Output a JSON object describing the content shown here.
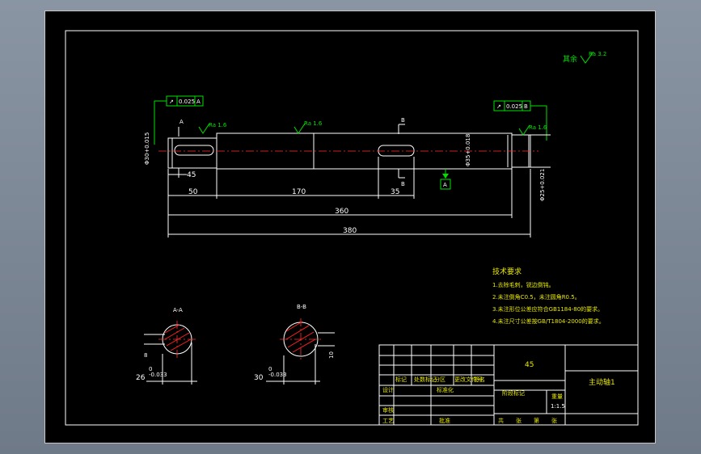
{
  "roughness_general": "Ra 3.2",
  "roughness_general_prefix": "其余",
  "roughness_left": "Ra 1.6",
  "roughness_mid": "Ra 1.6",
  "roughness_right": "Ra 1.6",
  "tol_frame_left": [
    "↗",
    "0.025",
    "A"
  ],
  "tol_frame_right": [
    "↗",
    "0.025",
    "B"
  ],
  "section_b_top": "B",
  "section_b_bottom": "B",
  "section_a_top": "A",
  "section_a_bottom": "A",
  "datum_a": "A",
  "dim_left_dia": "Φ30+0.015",
  "dim_mid_dia": "Φ35+0.018",
  "dim_right_dia": "Φ25+0.021",
  "dim_chamfer": "45",
  "dim_50": "50",
  "dim_170": "170",
  "dim_35": "35",
  "dim_360": "360",
  "dim_380": "380",
  "tech_title": "技术要求",
  "tech_items": [
    "1.去除毛刺，锐边倒钝。",
    "2.未注倒角C0.5，未注圆角R0.5。",
    "3.未注形位公差应符合GB1184-80的要求。",
    "4.未注尺寸公差按GB/T1804-2000的要求。"
  ],
  "sec_aa_label": "A-A",
  "sec_bb_label": "B-B",
  "sec_aa_dim_w": "8",
  "sec_aa_dim_h": "26",
  "sec_aa_tol": "0\n-0.033",
  "sec_bb_dim_w": "10",
  "sec_bb_dim_h": "30",
  "sec_bb_tol": "0\n-0.033",
  "title_material": "45",
  "title_part": "主动轴1",
  "title_scale": "1:1.5",
  "title_row_labels": [
    "标记",
    "处数",
    "分区",
    "更改文件号",
    "签名",
    "年、月、日"
  ],
  "title_design": "设计",
  "title_std": "标准化",
  "title_check": "审核",
  "title_craft": "工艺",
  "title_approve": "批准",
  "title_stage": "阶段标记",
  "title_weight": "重量",
  "title_ratio": "比例",
  "title_sheets": [
    "共",
    "张",
    "第",
    "张"
  ]
}
